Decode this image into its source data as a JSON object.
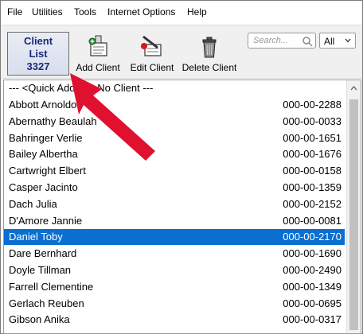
{
  "menu": [
    "File",
    "Utilities",
    "Tools",
    "Internet Options",
    "Help"
  ],
  "toolbar": {
    "client_list_line1": "Client",
    "client_list_line2": "List",
    "client_count": "3327",
    "add_client": "Add Client",
    "edit_client": "Edit Client",
    "delete_client": "Delete Client"
  },
  "search": {
    "placeholder": "Search..."
  },
  "filter": {
    "value": "All"
  },
  "list": {
    "header_text": "--- <Quick Add> --- No Client ---",
    "rows": [
      {
        "name": "Abbott Arnoldo",
        "id": "000-00-2288"
      },
      {
        "name": "Abernathy Beaulah",
        "id": "000-00-0033"
      },
      {
        "name": "Bahringer Verlie",
        "id": "000-00-1651"
      },
      {
        "name": "Bailey Albertha",
        "id": "000-00-1676"
      },
      {
        "name": "Cartwright Elbert",
        "id": "000-00-0158"
      },
      {
        "name": "Casper Jacinto",
        "id": "000-00-1359"
      },
      {
        "name": "Dach Julia",
        "id": "000-00-2152"
      },
      {
        "name": "D'Amore Jannie",
        "id": "000-00-0081"
      },
      {
        "name": "Daniel Toby",
        "id": "000-00-2170",
        "selected": true
      },
      {
        "name": "Dare Bernhard",
        "id": "000-00-1690"
      },
      {
        "name": "Doyle Tillman",
        "id": "000-00-2490"
      },
      {
        "name": "Farrell Clementine",
        "id": "000-00-1349"
      },
      {
        "name": "Gerlach Reuben",
        "id": "000-00-0695"
      },
      {
        "name": "Gibson Anika",
        "id": "000-00-0317"
      }
    ]
  },
  "colors": {
    "selection": "#0a6fd1",
    "annotation_arrow": "#e0102f"
  }
}
